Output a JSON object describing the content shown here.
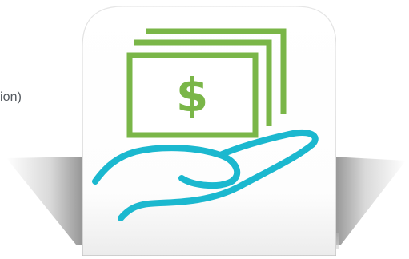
{
  "page": {
    "side_label": "ion)"
  },
  "icon": {
    "name": "money-in-hand-icon",
    "glyph": "$",
    "colors": {
      "bill": "#7ab648",
      "hand": "#1bb8cf",
      "tile": "#ffffff",
      "shadow": "#8f8f8f"
    }
  }
}
